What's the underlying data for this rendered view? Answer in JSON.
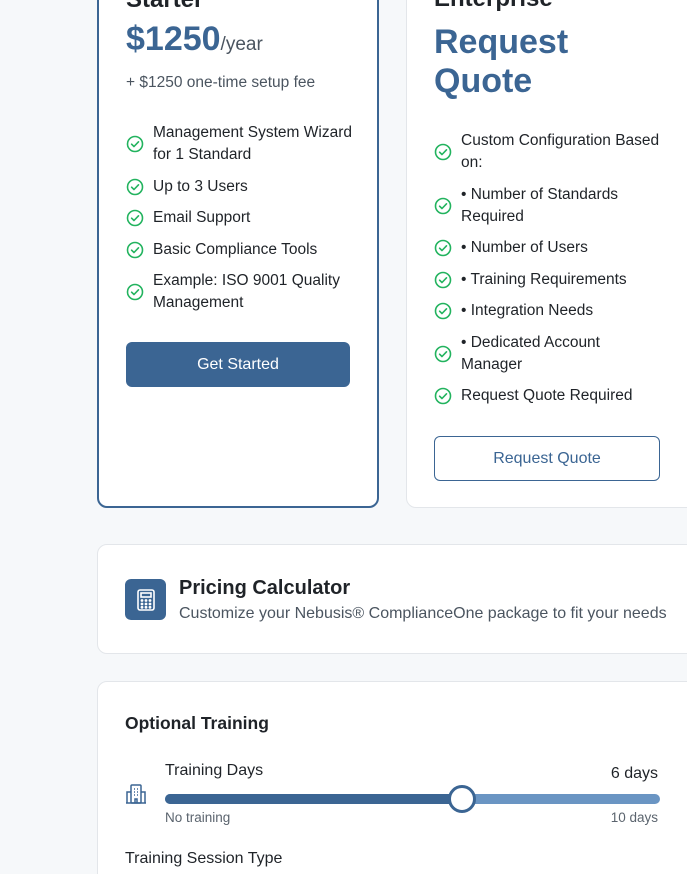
{
  "starter": {
    "name": "Starter",
    "price": "$1250",
    "period": "/year",
    "setup_fee": "+ $1250 one-time setup fee",
    "features": [
      "Management System Wizard for 1 Standard",
      "Up to 3 Users",
      "Email Support",
      "Basic Compliance Tools",
      "Example: ISO 9001 Quality Management"
    ],
    "cta": "Get Started"
  },
  "enterprise": {
    "name": "Enterprise",
    "price_text": "Request Quote",
    "features": [
      "Custom Configuration Based on:",
      "• Number of Standards Required",
      "• Number of Users",
      "• Training Requirements",
      "• Integration Needs",
      "• Dedicated Account Manager",
      "Request Quote Required"
    ],
    "cta": "Request Quote"
  },
  "calculator": {
    "title": "Pricing Calculator",
    "subtitle": "Customize your Nebusis® ComplianceOne package to fit your needs",
    "icon": "calculator-icon"
  },
  "training": {
    "title": "Optional Training",
    "slider": {
      "label": "Training Days",
      "value": 6,
      "value_text": "6 days",
      "min": 0,
      "max": 10,
      "min_label": "No training",
      "max_label": "10 days"
    },
    "session_type_label": "Training Session Type"
  },
  "colors": {
    "brand": "#3b6593",
    "check": "#22b35e",
    "track_light": "#6a95c3"
  }
}
